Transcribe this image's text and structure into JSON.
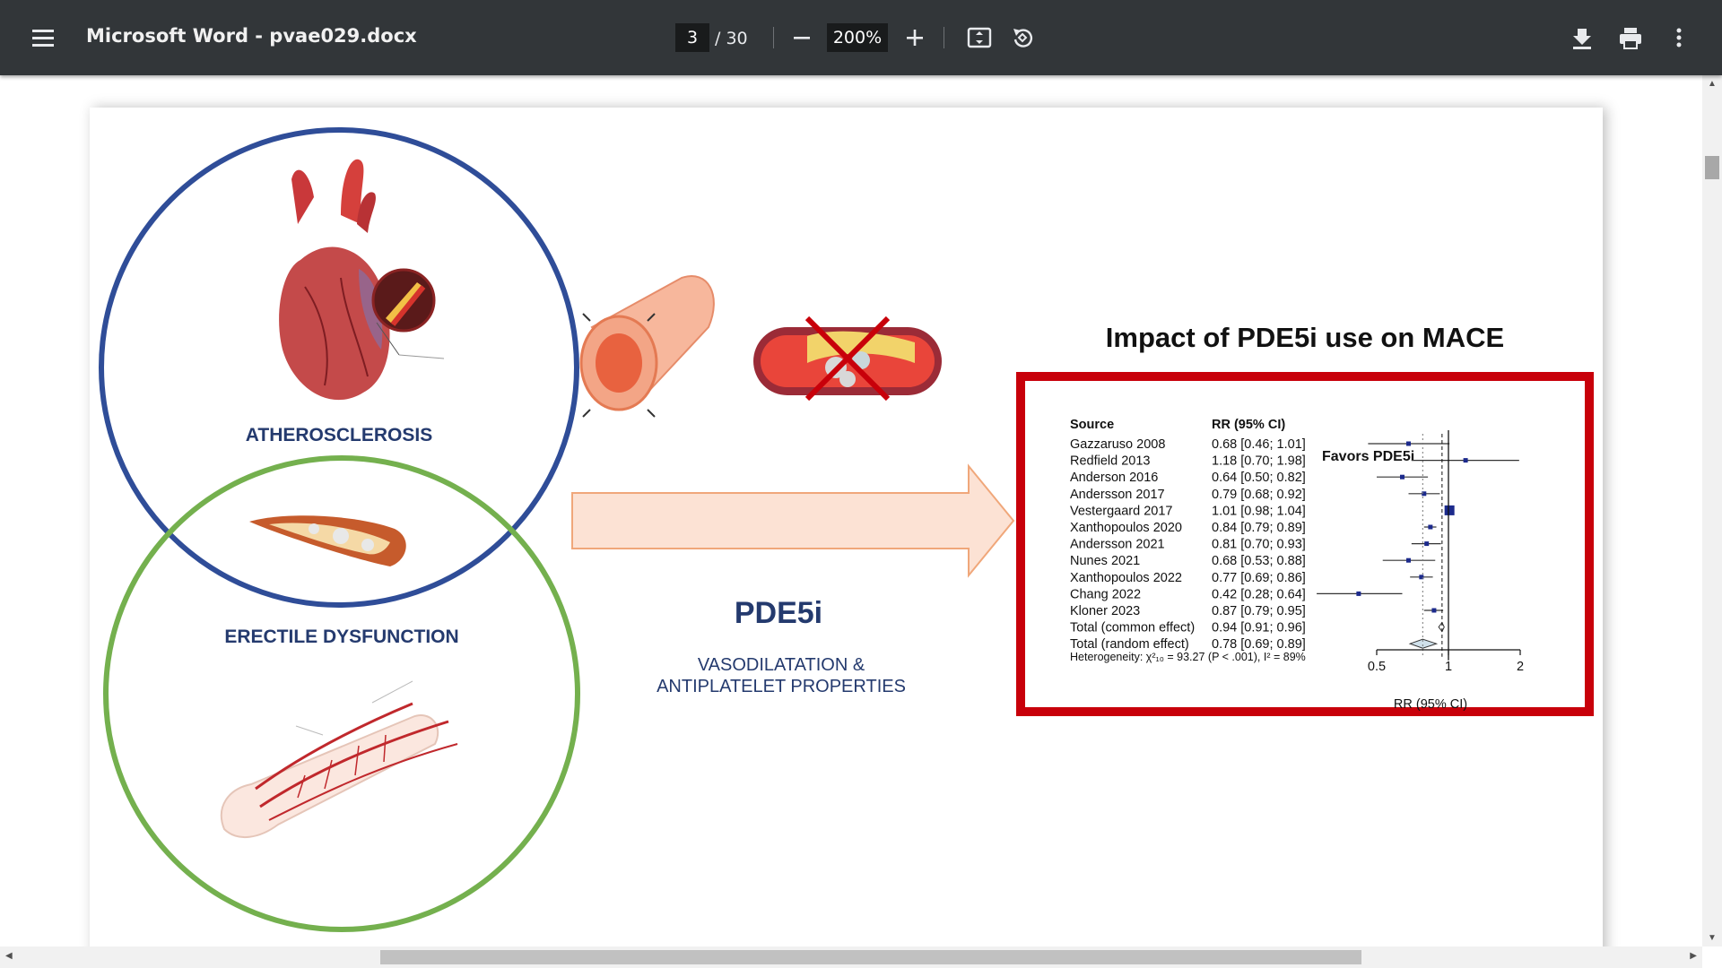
{
  "toolbar": {
    "title": "Microsoft Word - pvae029.docx",
    "page_current": "3",
    "page_total": "/ 30",
    "zoom": "200%"
  },
  "figure": {
    "atherosclerosis_label": "ATHEROSCLEROSIS",
    "ed_label": "ERECTILE DYSFUNCTION",
    "drug_name": "PDE5i",
    "drug_desc_line1": "VASODILATATION &",
    "drug_desc_line2": "ANTIPLATELET PROPERTIES",
    "impact_title": "Impact of PDE5i use on MACE",
    "forest_header_source": "Source",
    "forest_header_rr": "RR (95% CI)",
    "favors_label": "Favors PDE5i",
    "heterogeneity": "Heterogeneity: χ²₁₀ = 93.27 (P < .001), I² = 89%",
    "axis_label": "RR (95% CI)",
    "colors": {
      "atherosclerosis_circle": "#2f4d98",
      "ed_circle": "#74b04e",
      "forest_frame": "#c8000a",
      "arrow": "#fce2d4"
    }
  },
  "chart_data": {
    "type": "forest",
    "xlabel": "RR (95% CI)",
    "xscale": "log",
    "xticks": [
      0.5,
      1,
      2
    ],
    "reference_line": 1,
    "studies": [
      {
        "source": "Gazzaruso 2008",
        "rr_text": "0.68 [0.46; 1.01]",
        "rr": 0.68,
        "lo": 0.46,
        "hi": 1.01
      },
      {
        "source": "Redfield 2013",
        "rr_text": "1.18 [0.70; 1.98]",
        "rr": 1.18,
        "lo": 0.7,
        "hi": 1.98
      },
      {
        "source": "Anderson 2016",
        "rr_text": "0.64 [0.50; 0.82]",
        "rr": 0.64,
        "lo": 0.5,
        "hi": 0.82
      },
      {
        "source": "Andersson 2017",
        "rr_text": "0.79 [0.68; 0.92]",
        "rr": 0.79,
        "lo": 0.68,
        "hi": 0.92
      },
      {
        "source": "Vestergaard 2017",
        "rr_text": "1.01 [0.98; 1.04]",
        "rr": 1.01,
        "lo": 0.98,
        "hi": 1.04
      },
      {
        "source": "Xanthopoulos 2020",
        "rr_text": "0.84 [0.79; 0.89]",
        "rr": 0.84,
        "lo": 0.79,
        "hi": 0.89
      },
      {
        "source": "Andersson 2021",
        "rr_text": "0.81 [0.70; 0.93]",
        "rr": 0.81,
        "lo": 0.7,
        "hi": 0.93
      },
      {
        "source": "Nunes 2021",
        "rr_text": "0.68 [0.53; 0.88]",
        "rr": 0.68,
        "lo": 0.53,
        "hi": 0.88
      },
      {
        "source": "Xanthopoulos 2022",
        "rr_text": "0.77 [0.69; 0.86]",
        "rr": 0.77,
        "lo": 0.69,
        "hi": 0.86
      },
      {
        "source": "Chang 2022",
        "rr_text": "0.42 [0.28; 0.64]",
        "rr": 0.42,
        "lo": 0.28,
        "hi": 0.64
      },
      {
        "source": "Kloner 2023",
        "rr_text": "0.87 [0.79; 0.95]",
        "rr": 0.87,
        "lo": 0.79,
        "hi": 0.95
      }
    ],
    "totals": [
      {
        "source": "Total (common effect)",
        "rr_text": "0.94 [0.91; 0.96]",
        "rr": 0.94,
        "lo": 0.91,
        "hi": 0.96
      },
      {
        "source": "Total (random effect)",
        "rr_text": "0.78 [0.69; 0.89]",
        "rr": 0.78,
        "lo": 0.69,
        "hi": 0.89
      }
    ]
  }
}
